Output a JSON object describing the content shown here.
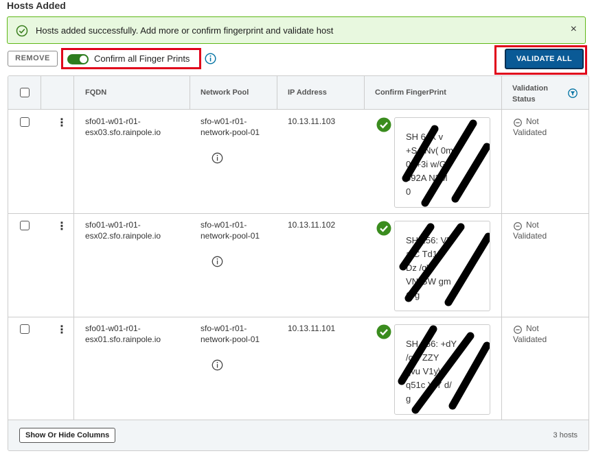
{
  "section": {
    "title": "Hosts Added"
  },
  "alert": {
    "message": "Hosts added successfully. Add more or confirm fingerprint and validate host",
    "close_glyph": "×",
    "color": "#5eb715"
  },
  "toolbar": {
    "remove_label": "REMOVE",
    "confirm_toggle_label": "Confirm all Finger Prints",
    "confirm_toggle_on": true,
    "validate_all_label": "VALIDATE ALL"
  },
  "grid": {
    "columns": {
      "fqdn": "FQDN",
      "network_pool": "Network Pool",
      "ip_address": "IP Address",
      "confirm_fingerprint": "Confirm FingerPrint",
      "validation_status": [
        "Validation",
        "Status"
      ]
    },
    "rows": [
      {
        "fqdn": [
          "sfo01-w01-r01-",
          "esx03.sfo.rainpole.io"
        ],
        "network_pool": [
          "sfo-w01-r01-",
          "network-pool-01"
        ],
        "ip": "10.13.11.103",
        "fingerprint": [
          "SH   6:lX  v",
          "+S  gNv(  0m",
          "  0L+3i  w/G",
          "  592A  N3M",
          "0"
        ],
        "status": [
          "Not",
          "Validated"
        ]
      },
      {
        "fqdn": [
          "sfo01-w01-r01-",
          "esx02.sfo.rainpole.io"
        ],
        "network_pool": [
          "sfo-w01-r01-",
          "network-pool-01"
        ],
        "ip": "10.13.11.102",
        "fingerprint": [
          "SH  256:  VN",
          "  a/C  Td1f",
          "  Dz  /qW",
          "VN  GW  gm",
          "C  g"
        ],
        "status": [
          "Not",
          "Validated"
        ]
      },
      {
        "fqdn": [
          "sfo01-w01-r01-",
          "esx01.sfo.rainpole.io"
        ],
        "network_pool": [
          "sfo-w01-r01-",
          "network-pool-01"
        ],
        "ip": "10.13.11.101",
        "fingerprint": [
          "SH  256:  +dY",
          "  /oN  ZZY",
          "  qvu  V1y\\",
          "q51c  YfY  d/",
          "g"
        ],
        "status": [
          "Not",
          "Validated"
        ]
      }
    ],
    "footer": {
      "columns_button": "Show Or Hide Columns",
      "count": "3 hosts"
    }
  },
  "colors": {
    "accent": "#0a5a96",
    "success": "#2e7d1f",
    "highlight": "#e0001a",
    "info": "#0072a3"
  }
}
